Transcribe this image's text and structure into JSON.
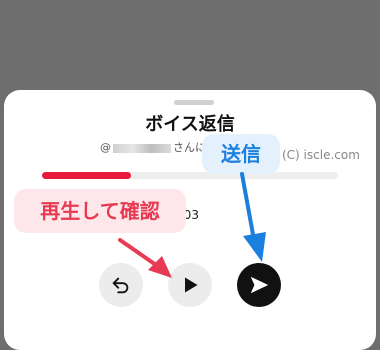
{
  "sheet": {
    "title": "ボイス返信",
    "subtitle_prefix": "@",
    "subtitle_suffix": "さんに返",
    "time": "0:03",
    "progress_fraction": 0.3
  },
  "watermark": "(C) iscle.com",
  "annotations": {
    "send_label": "送信",
    "play_label": "再生して確認"
  },
  "controls": {
    "undo_icon": "undo-icon",
    "play_icon": "play-icon",
    "send_icon": "send-icon"
  },
  "colors": {
    "progress": "#e8193c",
    "send_button": "#111111",
    "send_annotation": "#1a7fde",
    "play_annotation": "#e83a52"
  }
}
